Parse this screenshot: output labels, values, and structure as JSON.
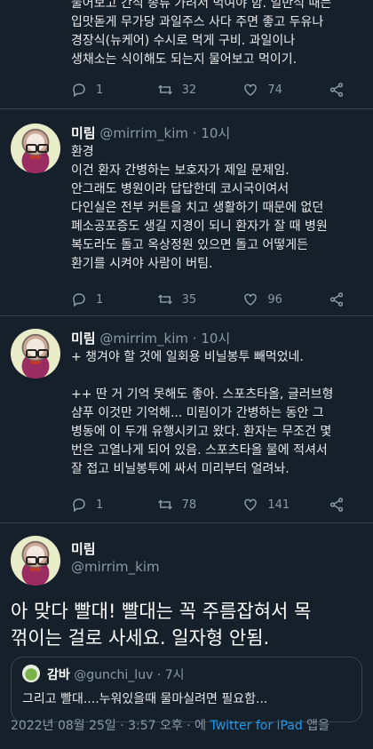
{
  "tweets": [
    {
      "body": "물어보고 간식 종류 가려서 먹여야 함. 일반식 때는\n입맛돋게 무가당 과일주스 사다 주면 좋고 두유나\n경장식(뉴케어) 수시로 먹게 구비. 과일이나\n생채소는 식이해도 되는지 물어보고 먹이기.",
      "replies": "1",
      "retweets": "32",
      "likes": "74"
    },
    {
      "name": "미림",
      "handle": "@mirrim_kim",
      "time": "· 10시",
      "body": "환경\n이건 환자 간병하는 보호자가 제일 문제임.\n안그래도 병원이라 답답한데 코시국이여서\n다인실은 전부 커튼을 치고 생활하기 때문에 없던\n폐소공포증도 생길 지경이 되니 환자가 잘 때 병원\n복도라도 돌고 옥상정원 있으면 돌고 어떻게든\n환기를 시켜야 사람이 버팀.",
      "replies": "1",
      "retweets": "35",
      "likes": "96"
    },
    {
      "name": "미림",
      "handle": "@mirrim_kim",
      "time": "· 10시",
      "body": "+ 챙겨야 할 것에 일회용 비닐봉투 빼먹었네.\n\n++ 딴 거 기억 못해도 좋아. 스포츠타올, 글러브형\n샴푸 이것만 기억해... 미림이가 간병하는 동안 그\n병동에 이 두개 유행시키고 왔다. 환자는 무조건 몇\n번은 고열나게 되어 있음. 스포츠타올 물에 적셔서\n잘 접고 비닐봉투에 싸서 미리부터 얼려놔.",
      "replies": "1",
      "retweets": "78",
      "likes": "141"
    }
  ],
  "main_tweet": {
    "name": "미림",
    "handle": "@mirrim_kim",
    "text": "아 맞다 빨대! 빨대는 꼭 주름잡혀서 목\n꺾이는 걸로 사세요. 일자형 안됨.",
    "quote": {
      "name": "감바",
      "handle": "@gunchi_luv",
      "time": "· 7시",
      "text": "그리고 빨대....누워있을때 물마실려면 필요함..."
    },
    "footer": {
      "timestamp": "2022년 08월 25일 · 3:57 오후 · 에 ",
      "source": "Twitter for iPad",
      "suffix": " 앱을"
    }
  },
  "colors": {
    "background": "#15202b",
    "accent": "#1d9bf0",
    "muted": "#8b98a5"
  }
}
